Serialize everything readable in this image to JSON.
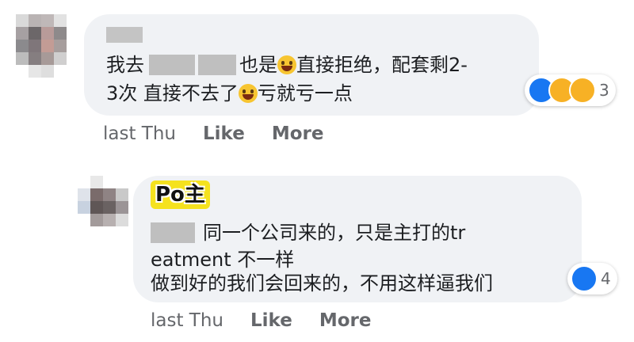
{
  "comment1": {
    "line1_a": "我去",
    "line1_b": "也是",
    "line1_c": "直接拒绝，配套剩2-",
    "line2_a": "3次 直接不去了",
    "line2_b": "亏就亏一点",
    "reaction_count": "3",
    "time": "last Thu",
    "like_label": "Like",
    "more_label": "More"
  },
  "comment2": {
    "badge": "Po主",
    "line1": "同一个公司来的，只是主打的tr",
    "line2": "eatment 不一样",
    "line3": "做到好的我们会回来的，不用这样逼我们",
    "reaction_count": "4",
    "time": "last Thu",
    "like_label": "Like",
    "more_label": "More"
  },
  "icons": [
    "avatar-1",
    "avatar-2",
    "laughing-emoji-icon",
    "like-reaction-icon",
    "haha-reaction-icon",
    "care-reaction-icon"
  ],
  "colors": {
    "bubble": "#f0f2f5",
    "like_blue": "#1877f2",
    "badge_yellow": "#f5e21e",
    "meta_gray": "#65676b"
  }
}
